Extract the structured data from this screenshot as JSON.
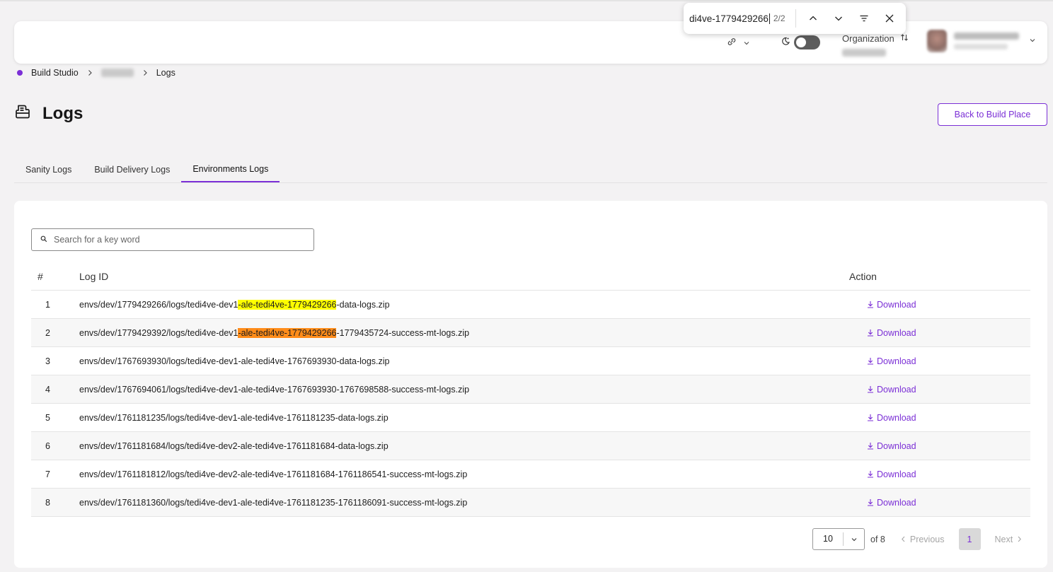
{
  "find_bar": {
    "query": "di4ve-1779429266",
    "count": "2/2",
    "icons": [
      "chevron-up-icon",
      "chevron-down-icon",
      "filter-icon",
      "close-icon"
    ]
  },
  "header": {
    "organization_label": "Organization",
    "icons": [
      "link-icon",
      "moon-icon",
      "swap-icon",
      "chevron-down-icon"
    ],
    "theme_toggle_on": false
  },
  "breadcrumb": {
    "items": [
      "Build Studio",
      "Logs"
    ]
  },
  "page": {
    "title": "Logs",
    "back_button": "Back to Build Place"
  },
  "tabs": [
    {
      "label": "Sanity Logs",
      "active": false
    },
    {
      "label": "Build Delivery Logs",
      "active": false
    },
    {
      "label": "Environments Logs",
      "active": true
    }
  ],
  "search": {
    "placeholder": "Search for a key word"
  },
  "table": {
    "columns": [
      "#",
      "Log ID",
      "Action"
    ],
    "action_label": "Download",
    "rows": [
      {
        "num": "1",
        "pre": "envs/dev/1779429266/logs/tedi4ve-dev1",
        "match": "-ale-tedi4ve-1779429266",
        "post": "-data-logs.zip",
        "current": false
      },
      {
        "num": "2",
        "pre": "envs/dev/1779429392/logs/tedi4ve-dev1",
        "match": "-ale-tedi4ve-1779429266",
        "post": "-1779435724-success-mt-logs.zip",
        "current": true
      },
      {
        "num": "3",
        "pre": "envs/dev/1767693930/logs/tedi4ve-dev1-ale-tedi4ve-1767693930-data-logs.zip",
        "match": "",
        "post": "",
        "current": false
      },
      {
        "num": "4",
        "pre": "envs/dev/1767694061/logs/tedi4ve-dev1-ale-tedi4ve-1767693930-1767698588-success-mt-logs.zip",
        "match": "",
        "post": "",
        "current": false
      },
      {
        "num": "5",
        "pre": "envs/dev/1761181235/logs/tedi4ve-dev1-ale-tedi4ve-1761181235-data-logs.zip",
        "match": "",
        "post": "",
        "current": false
      },
      {
        "num": "6",
        "pre": "envs/dev/1761181684/logs/tedi4ve-dev2-ale-tedi4ve-1761181684-data-logs.zip",
        "match": "",
        "post": "",
        "current": false
      },
      {
        "num": "7",
        "pre": "envs/dev/1761181812/logs/tedi4ve-dev2-ale-tedi4ve-1761181684-1761186541-success-mt-logs.zip",
        "match": "",
        "post": "",
        "current": false
      },
      {
        "num": "8",
        "pre": "envs/dev/1761181360/logs/tedi4ve-dev1-ale-tedi4ve-1761181235-1761186091-success-mt-logs.zip",
        "match": "",
        "post": "",
        "current": false
      }
    ]
  },
  "pagination": {
    "page_size": "10",
    "of_label": "of 8",
    "previous": "Previous",
    "current_page": "1",
    "next": "Next"
  },
  "colors": {
    "accent": "#7b2fd6",
    "find_match": "#ffff00",
    "find_current": "#ff8c1a"
  }
}
